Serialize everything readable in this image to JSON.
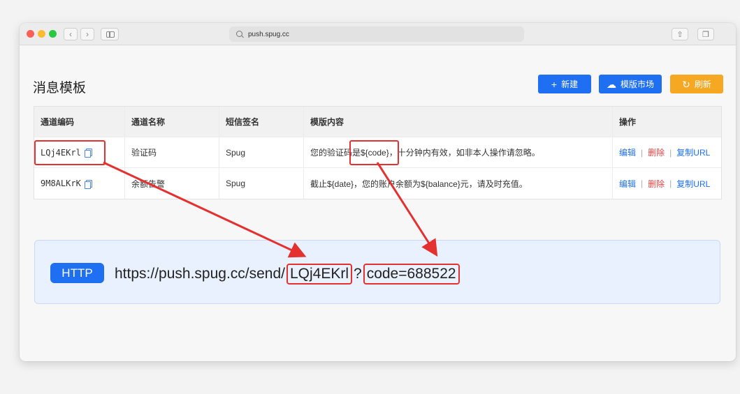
{
  "browser": {
    "url": "push.spug.cc"
  },
  "page": {
    "title": "消息模板"
  },
  "toolbar": {
    "new_label": "新建",
    "market_label": "模版市场",
    "refresh_label": "刷新"
  },
  "table": {
    "headers": [
      "通道编码",
      "通道名称",
      "短信签名",
      "模版内容",
      "操作"
    ],
    "rows": [
      {
        "code": "LQj4EKrl",
        "name": "验证码",
        "sign": "Spug",
        "content": "您的验证码是${code}，十分钟内有效，如非本人操作请忽略。",
        "actions": {
          "edit": "编辑",
          "delete": "删除",
          "copy": "复制URL"
        }
      },
      {
        "code": "9M8ALKrK",
        "name": "余额告警",
        "sign": "Spug",
        "content": "截止${date}，您的账户余额为${balance}元，请及时充值。",
        "actions": {
          "edit": "编辑",
          "delete": "删除",
          "copy": "复制URL"
        }
      }
    ]
  },
  "http_example": {
    "badge": "HTTP",
    "base_url": "https://push.spug.cc/send/",
    "code_part": "LQj4EKrl",
    "separator": "?",
    "query_part": "code=688522"
  },
  "colors": {
    "primary": "#1e6ff1",
    "warning": "#f7a823",
    "danger": "#e04545",
    "annotation": "#e53030"
  },
  "icons": [
    "search-icon",
    "copy-icon",
    "plus-icon",
    "cloud-upload-icon",
    "refresh-icon",
    "share-icon",
    "tabs-icon",
    "sidebar-icon",
    "arrow-annotation"
  ]
}
